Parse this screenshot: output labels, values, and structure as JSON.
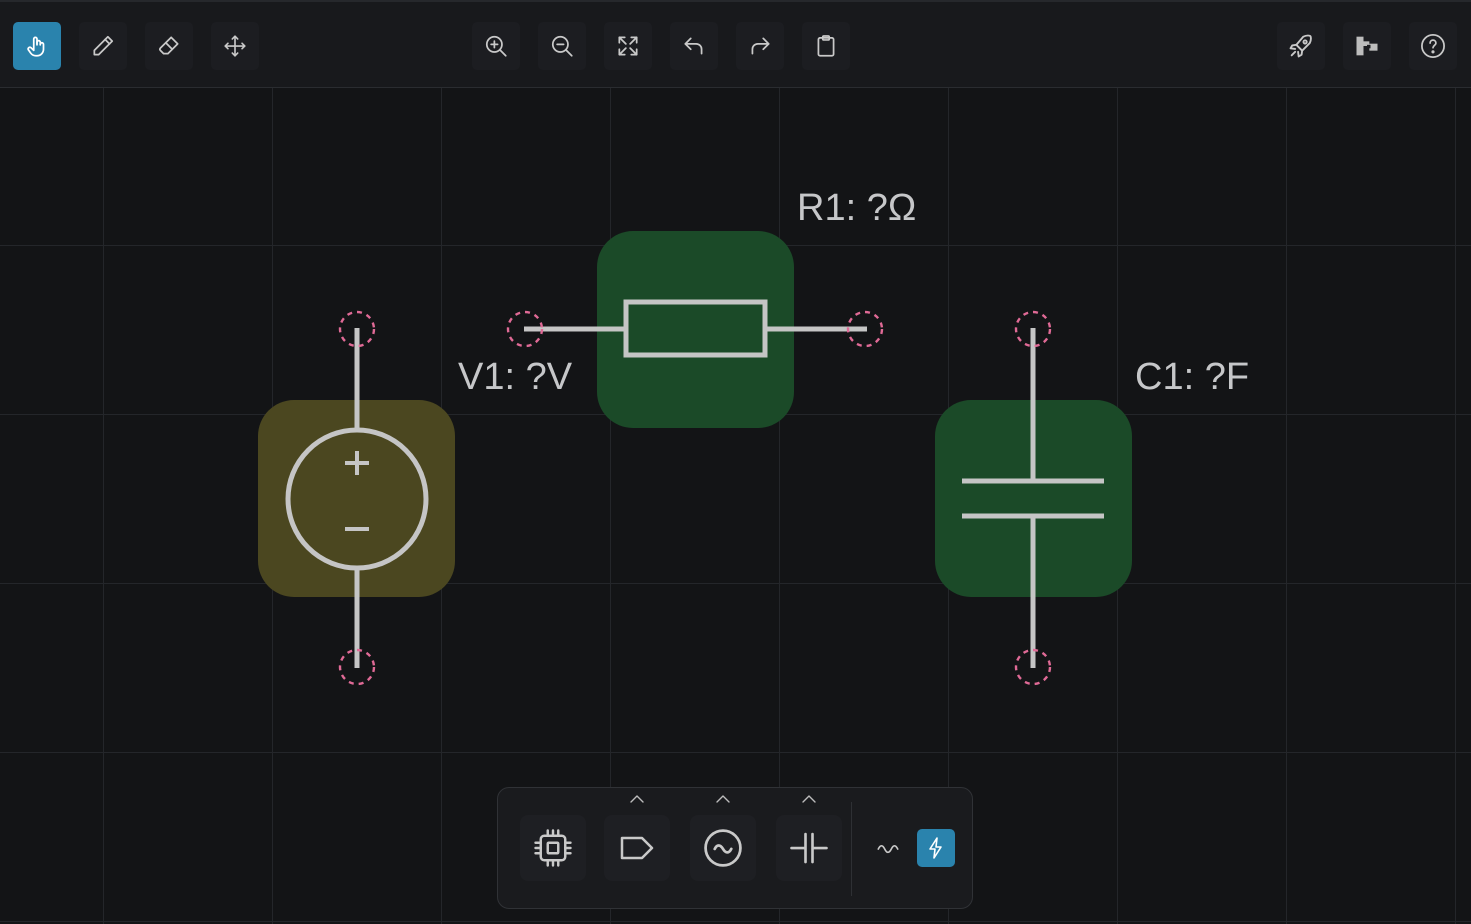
{
  "toolbar": {
    "left": [
      {
        "name": "pointer-tool-button",
        "icon": "hand-pointer-icon",
        "active": true
      },
      {
        "name": "pencil-tool-button",
        "icon": "pencil-icon",
        "active": false
      },
      {
        "name": "eraser-tool-button",
        "icon": "eraser-icon",
        "active": false
      },
      {
        "name": "move-tool-button",
        "icon": "move-arrows-icon",
        "active": false
      }
    ],
    "center": [
      {
        "name": "zoom-in-button",
        "icon": "zoom-in-icon"
      },
      {
        "name": "zoom-out-button",
        "icon": "zoom-out-icon"
      },
      {
        "name": "fit-view-button",
        "icon": "expand-icon"
      },
      {
        "name": "undo-button",
        "icon": "undo-icon"
      },
      {
        "name": "redo-button",
        "icon": "redo-icon"
      },
      {
        "name": "clipboard-button",
        "icon": "clipboard-icon"
      }
    ],
    "right": [
      {
        "name": "run-simulation-button",
        "icon": "rocket-icon"
      },
      {
        "name": "export-button",
        "icon": "netlist-icon"
      },
      {
        "name": "help-button",
        "icon": "help-circle-icon"
      }
    ]
  },
  "components": {
    "voltage_source": {
      "label": "V1: ?V",
      "fill": "#4b4720"
    },
    "resistor": {
      "label": "R1: ?Ω",
      "fill": "#1b4a28"
    },
    "capacitor": {
      "label": "C1: ?F",
      "fill": "#1b4a28"
    }
  },
  "palette": {
    "items": [
      {
        "name": "palette-chip-button",
        "icon": "chip-icon"
      },
      {
        "name": "palette-label-button",
        "icon": "tag-icon"
      },
      {
        "name": "palette-source-button",
        "icon": "ac-source-icon"
      },
      {
        "name": "palette-capacitor-button",
        "icon": "capacitor-icon"
      }
    ],
    "modes": [
      {
        "name": "wave-mode-button",
        "icon": "wave-icon",
        "active": false
      },
      {
        "name": "power-mode-button",
        "icon": "lightning-icon",
        "active": true
      }
    ]
  },
  "colors": {
    "accent": "#2a83ad",
    "background": "#131416",
    "grid": "#24262a",
    "wire": "#c5c5c5",
    "terminal": "#e06a96"
  }
}
